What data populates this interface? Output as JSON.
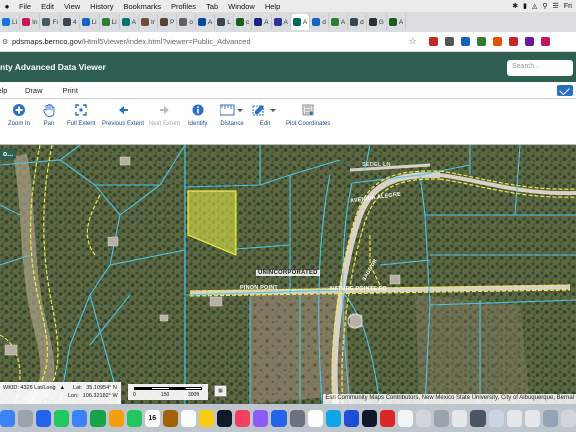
{
  "menubar": {
    "items": [
      "File",
      "Edit",
      "View",
      "History",
      "Bookmarks",
      "Profiles",
      "Tab",
      "Window",
      "Help"
    ],
    "clock": "Fri"
  },
  "tabs": [
    {
      "label": "Li",
      "color": "#1a73e8"
    },
    {
      "label": "In",
      "color": "#c2185b"
    },
    {
      "label": "Fi",
      "color": "#455a64"
    },
    {
      "label": "4",
      "color": "#37474f"
    },
    {
      "label": "Li",
      "color": "#1565c0"
    },
    {
      "label": "Li",
      "color": "#2e7d32"
    },
    {
      "label": "A",
      "color": "#00796b"
    },
    {
      "label": "Ir",
      "color": "#6d4c41"
    },
    {
      "label": "P",
      "color": "#5d4037"
    },
    {
      "label": "o",
      "color": "#616161"
    },
    {
      "label": "A",
      "color": "#0d47a1"
    },
    {
      "label": "L",
      "color": "#37474f"
    },
    {
      "label": "c",
      "color": "#1b5e20"
    },
    {
      "label": "A",
      "color": "#1a237e"
    },
    {
      "label": "A",
      "color": "#283593"
    },
    {
      "label": "A",
      "color": "#00695c"
    },
    {
      "label": "d",
      "color": "#1565c0"
    },
    {
      "label": "A",
      "color": "#2e7d32"
    },
    {
      "label": "d",
      "color": "#37474f"
    },
    {
      "label": "G",
      "color": "#263238"
    },
    {
      "label": "A",
      "color": "#1b5e20"
    }
  ],
  "address": {
    "url_host": "pdsmaps.bernco.gov",
    "url_path": "/Html5Viewer/index.html?viewer=Public_Advanced"
  },
  "app": {
    "title": "nty Advanced Data Viewer",
    "search_placeholder": "Search...",
    "menus": [
      "Help",
      "Draw",
      "Print"
    ]
  },
  "toolbar": {
    "tools": [
      {
        "label": "Zoom In",
        "icon": "plus-icon",
        "enabled": true
      },
      {
        "label": "Pan",
        "icon": "hand-icon",
        "enabled": true
      },
      {
        "label": "Full Extent",
        "icon": "expand-icon",
        "enabled": true
      },
      {
        "label": "Previous Extent",
        "icon": "back-arrow-icon",
        "enabled": true
      },
      {
        "label": "Next Extent",
        "icon": "forward-arrow-icon",
        "enabled": false
      },
      {
        "label": "Identify",
        "icon": "info-icon",
        "enabled": true
      },
      {
        "label": "Distance",
        "icon": "ruler-icon",
        "enabled": true
      },
      {
        "label": "Edit",
        "icon": "edit-icon",
        "enabled": true
      },
      {
        "label": "Plot Coordinates",
        "icon": "coordinates-icon",
        "enabled": true
      }
    ]
  },
  "map": {
    "panel_tab": "o...",
    "labels": {
      "seddel": "SEDEL LN",
      "avenida": "AVENIDA ALEGRE",
      "unincorporated": "UNINCORPORATED",
      "pinon": "PINON POINT",
      "nature": "NATURE POINTE RD",
      "sage": "SAGE DR"
    },
    "coords": {
      "wkid": "WKID: 4326 Lat/Long",
      "lat_label": "Lat:",
      "lat": "35.10954° N",
      "lon_label": "Lon:",
      "lon": "106.32182° W"
    },
    "scale": {
      "t0": "0",
      "t1": "150",
      "t2": "300ft"
    },
    "attribution": "Esri Community Maps Contributors, New Mexico State University, City of Albuquerque, Bernal",
    "colors": {
      "parcel": "#4ec3e6",
      "road": "#f2e84a",
      "selected": "#e8ec4a"
    }
  },
  "dock": {
    "calendar_day": "16",
    "apps": [
      "finder",
      "launchpad",
      "safari",
      "messages",
      "mail",
      "maps",
      "photos",
      "facetime",
      "calendar",
      "contacts",
      "reminders",
      "notes",
      "tv",
      "music",
      "podcasts",
      "appstore",
      "settings",
      "chrome",
      "safari2",
      "word",
      "cricut",
      "app-i",
      "app-white",
      "app-gray",
      "app-dot",
      "app-doc",
      "calculator",
      "app-mid",
      "app-blank",
      "app-blank2",
      "app-photo",
      "trash"
    ]
  }
}
